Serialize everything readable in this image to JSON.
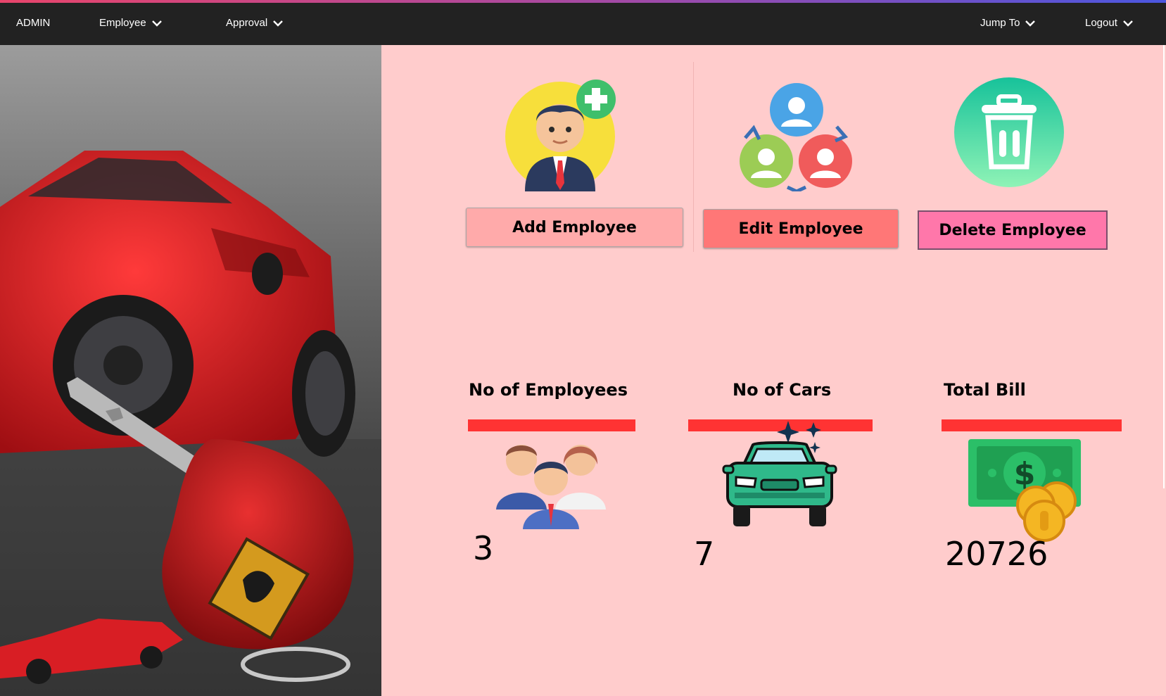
{
  "nav": {
    "brand": "ADMIN",
    "employee": "Employee",
    "approval": "Approval",
    "jump_to": "Jump To",
    "logout": "Logout",
    "accent_gradient": [
      "#e8456b",
      "#a04aa8",
      "#4b57e0"
    ]
  },
  "side_image": {
    "subject": "red-sports-car-with-key"
  },
  "actions": {
    "add_label": "Add Employee",
    "edit_label": "Edit Employee",
    "delete_label": "Delete Employee"
  },
  "stats": {
    "employees_title": "No of Employees",
    "employees_value": "3",
    "cars_title": "No of Cars",
    "cars_value": "7",
    "bill_title": "Total Bill",
    "bill_value": "20726"
  },
  "icons": {
    "add": "add-employee-icon",
    "edit": "edit-employee-icon",
    "delete": "trash-icon",
    "employees": "employees-group-icon",
    "cars": "car-icon",
    "bill": "money-icon"
  },
  "colors": {
    "content_bg": "#ffcccc",
    "stat_bar": "#ff3333",
    "add_button": "#ffaaaa",
    "edit_button": "#ff7777",
    "delete_button": "#ff77aa"
  }
}
